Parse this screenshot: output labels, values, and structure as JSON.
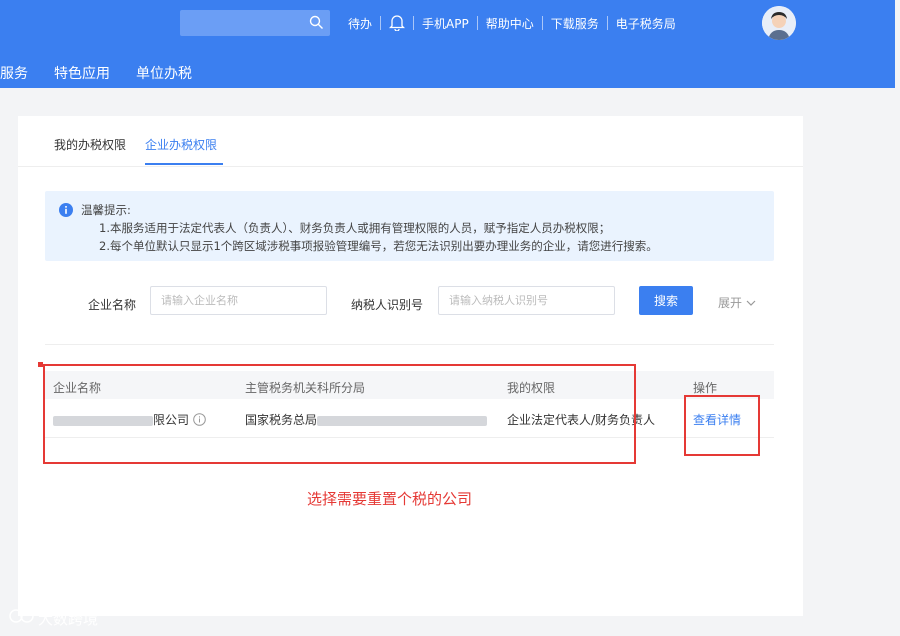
{
  "header": {
    "nav_top": [
      "待办",
      "手机APP",
      "帮助中心",
      "下载服务",
      "电子税务局"
    ],
    "nav_main": [
      "服务",
      "特色应用",
      "单位办税"
    ]
  },
  "tabs": [
    "我的办税权限",
    "企业办税权限"
  ],
  "notice": {
    "title": "温馨提示:",
    "line1": "1.本服务适用于法定代表人（负责人）、财务负责人或拥有管理权限的人员，赋予指定人员办税权限；",
    "line2": "2.每个单位默认只显示1个跨区域涉税事项报验管理编号，若您无法识别出要办理业务的企业，请您进行搜索。"
  },
  "filters": {
    "company_label": "企业名称",
    "company_placeholder": "请输入企业名称",
    "taxid_label": "纳税人识别号",
    "taxid_placeholder": "请输入纳税人识别号",
    "search_label": "搜索",
    "expand_label": "展开"
  },
  "table": {
    "headers": [
      "企业名称",
      "主管税务机关科所分局",
      "我的权限",
      "操作"
    ],
    "row": {
      "company_suffix": "限公司",
      "tax_office_prefix": "国家税务总局",
      "permission": "企业法定代表人/财务负责人",
      "action": "查看详情"
    }
  },
  "annotation": "选择需要重置个税的公司",
  "watermark": "大数跨境"
}
